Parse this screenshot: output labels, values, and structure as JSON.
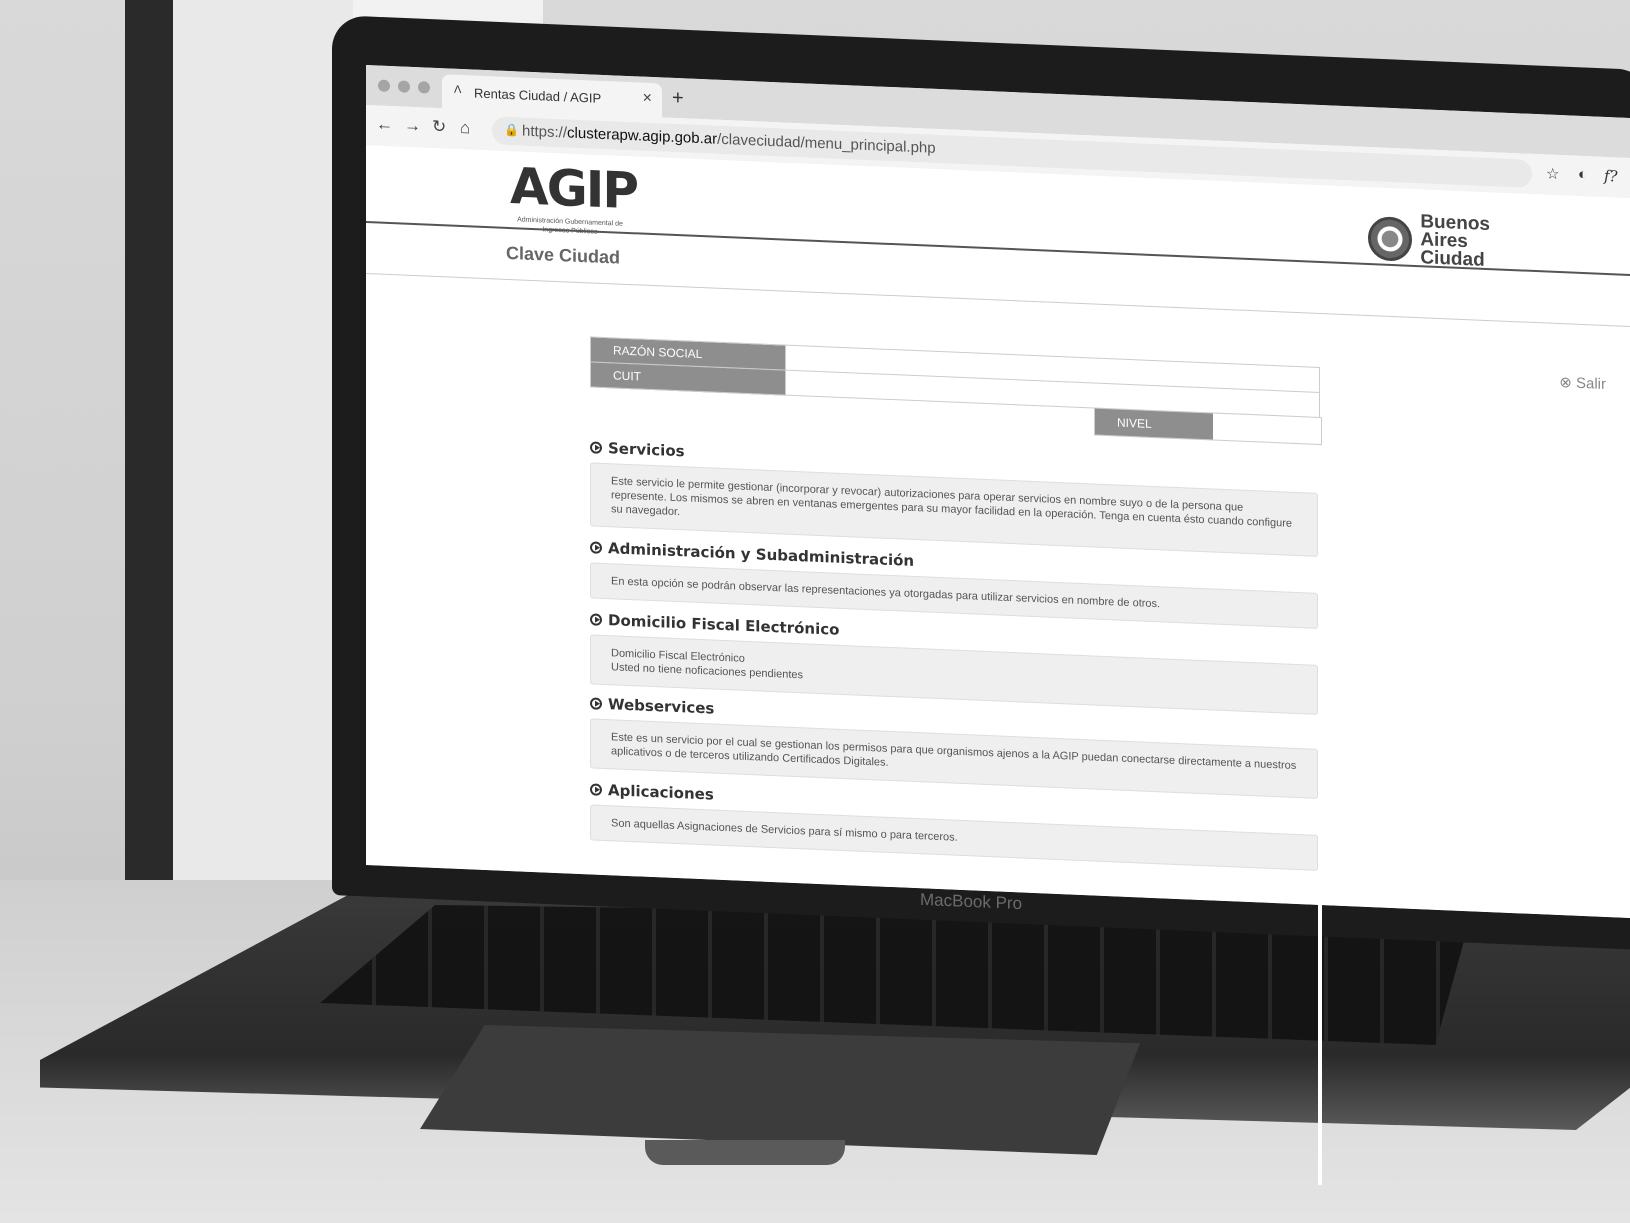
{
  "browser": {
    "tab_title": "Rentas Ciudad / AGIP",
    "url_prefix": "https://",
    "url_host": "clusterapw.agip.gob.ar",
    "url_path": "/claveciudad/menu_principal.php",
    "extension_icons": [
      "star-icon",
      "shield-icon",
      "function-icon",
      "off-badge-icon",
      "profile-icon",
      "more-icon"
    ]
  },
  "header": {
    "agip_logo": "AGIP",
    "agip_sub": "Administración Gubernamental de Ingresos Públicos",
    "ba_logo_lines": [
      "Buenos",
      "Aires",
      "Ciudad"
    ],
    "section_title": "Clave Ciudad",
    "logout_label": "Salir"
  },
  "info": {
    "razon_social_label": "RAZÓN SOCIAL",
    "cuit_label": "CUIT",
    "nivel_label": "NIVEL",
    "razon_social_value": "",
    "cuit_value": "",
    "nivel_value": ""
  },
  "services": [
    {
      "title": "Servicios",
      "description": "Este servicio le permite gestionar (incorporar y revocar) autorizaciones para operar servicios en nombre suyo o de la persona que represente. Los mismos se abren en ventanas emergentes para su mayor facilidad en la operación. Tenga en cuenta ésto cuando configure su navegador."
    },
    {
      "title": "Administración y Subadministración",
      "description": "En esta opción se podrán observar las representaciones ya otorgadas para utilizar servicios en nombre de otros."
    },
    {
      "title": "Domicilio Fiscal Electrónico",
      "description_line1": "Domicilio Fiscal Electrónico",
      "description_line2": "Usted no tiene noficaciones pendientes"
    },
    {
      "title": "Webservices",
      "description": "Este es un servicio por el cual se gestionan los permisos para que organismos ajenos a la AGIP puedan conectarse directamente a nuestros aplicativos o de terceros utilizando Certificados Digitales."
    },
    {
      "title": "Aplicaciones",
      "description": "Son aquellas Asignaciones de Servicios para sí mismo o para terceros."
    }
  ],
  "device": {
    "label": "MacBook Pro"
  }
}
